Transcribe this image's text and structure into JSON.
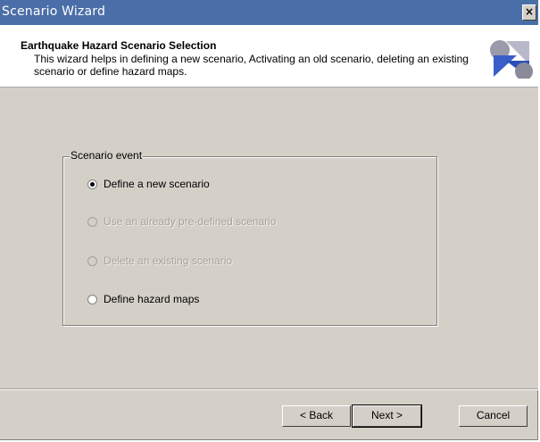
{
  "window": {
    "title": "Scenario Wizard",
    "close_label": "×"
  },
  "header": {
    "heading": "Earthquake Hazard Scenario Selection",
    "description": "This wizard helps in defining a new scenario, Activating an old scenario, deleting an existing scenario or define hazard maps.",
    "logo_icon": "wizard-logo-icon"
  },
  "scenario_group": {
    "legend": "Scenario event",
    "options": [
      {
        "label": "Define a new scenario",
        "checked": true,
        "enabled": true
      },
      {
        "label": "Use an already pre-defined scenario",
        "checked": false,
        "enabled": false
      },
      {
        "label": "Delete an existing scenario",
        "checked": false,
        "enabled": false
      },
      {
        "label": "Define hazard maps",
        "checked": false,
        "enabled": true
      }
    ]
  },
  "buttons": {
    "back": "< Back",
    "next": "Next >",
    "cancel": "Cancel"
  },
  "colors": {
    "titlebar": "#4a6ea8",
    "dialog_face": "#d4d0c8",
    "disabled_text": "#a6a39b"
  }
}
